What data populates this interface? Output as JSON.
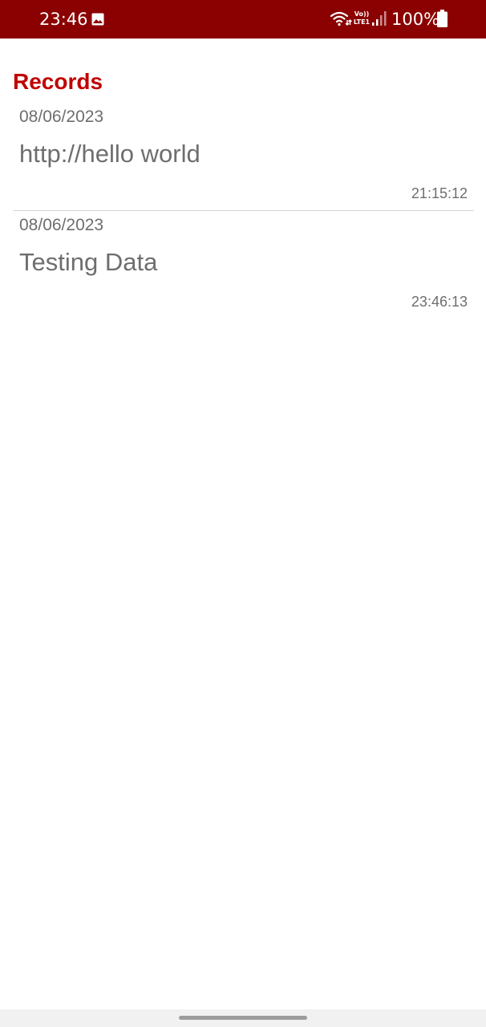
{
  "status_bar": {
    "time": "23:46",
    "network_label_top": "Vo))",
    "network_label_bottom": "LTE1",
    "battery_percent": "100%",
    "icons": [
      "gallery-icon",
      "wifi-icon",
      "volte-icon",
      "signal-icon",
      "battery-icon"
    ],
    "background_color": "#8b0000"
  },
  "header": {
    "title": "Records",
    "title_color": "#c00000"
  },
  "records": [
    {
      "date": "08/06/2023",
      "content": "http://hello world",
      "time": "21:15:12"
    },
    {
      "date": "08/06/2023",
      "content": "Testing Data",
      "time": "23:46:13"
    }
  ]
}
